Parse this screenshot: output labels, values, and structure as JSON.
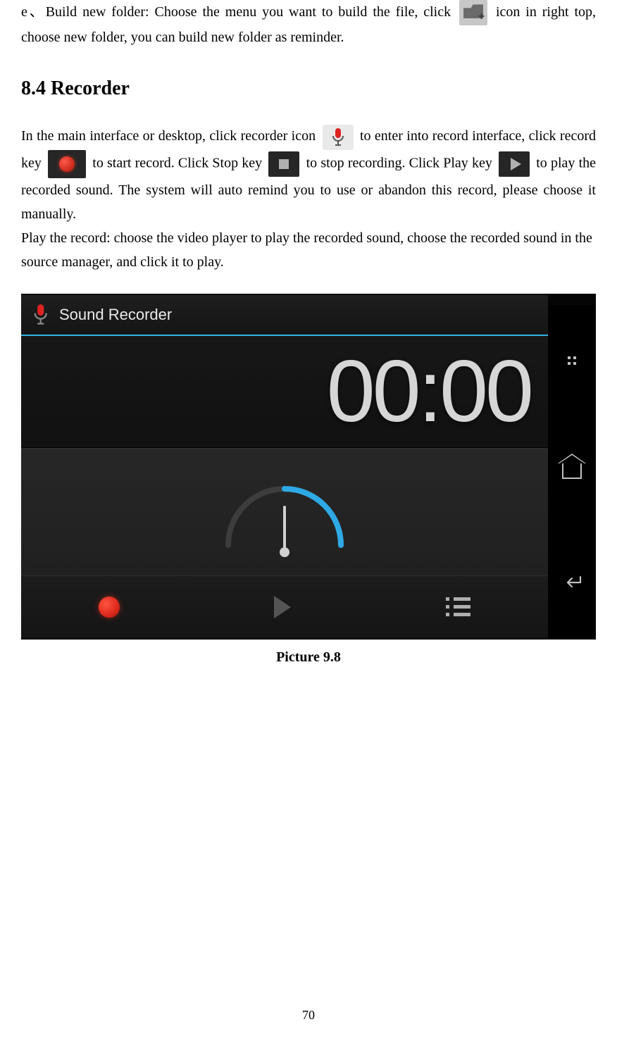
{
  "para_e_prefix": "e、Build new folder: Choose the menu you want to build the file, click ",
  "para_e_suffix": " icon in right top, choose new folder, you can build new folder as reminder.",
  "section_heading": "8.4 Recorder",
  "recorder_paragraph": {
    "p1_a": "In the main interface or desktop, click recorder icon ",
    "p1_b": " to enter into record interface, click record key ",
    "p1_c": " to start record. Click Stop key ",
    "p1_d": " to stop recording. Click Play key ",
    "p1_e": " to play the recorded sound. The system will auto remind you to use or abandon this record, please choose it manually.",
    "p2": "Play the record: choose the video player to play the recorded sound, choose the recorded sound in the source manager, and click it to play."
  },
  "screenshot": {
    "app_title": "Sound Recorder",
    "timer": "00:00"
  },
  "caption": "Picture 9.8",
  "page_number": "70"
}
